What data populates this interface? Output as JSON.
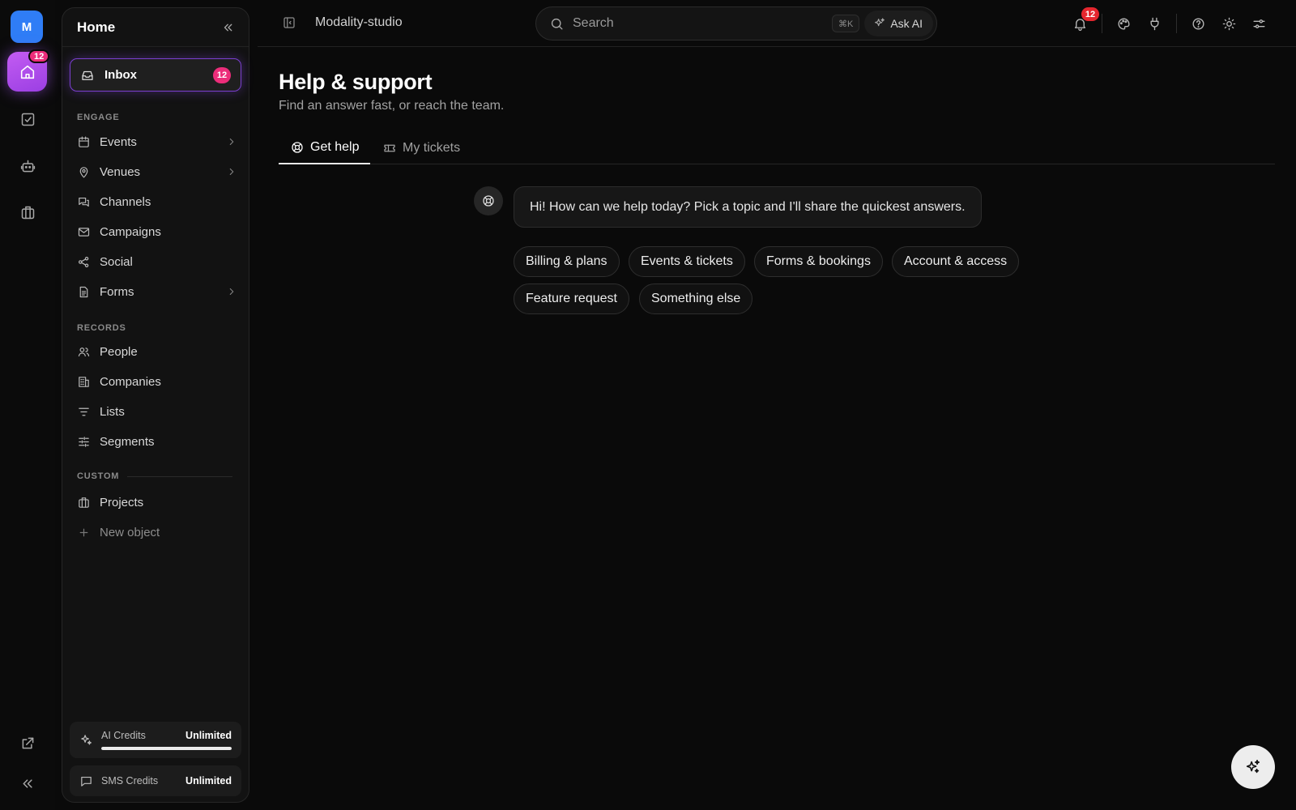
{
  "rail": {
    "avatar_letter": "M",
    "home_badge": "12"
  },
  "sidebar": {
    "title": "Home",
    "inbox": {
      "label": "Inbox",
      "badge": "12"
    },
    "sections": {
      "engage": "ENGAGE",
      "records": "RECORDS",
      "custom": "CUSTOM"
    },
    "engage_items": [
      {
        "label": "Events",
        "icon": "calendar-icon",
        "has_chevron": true
      },
      {
        "label": "Venues",
        "icon": "map-pin-icon",
        "has_chevron": true
      },
      {
        "label": "Channels",
        "icon": "chat-bubbles-icon",
        "has_chevron": false
      },
      {
        "label": "Campaigns",
        "icon": "mail-icon",
        "has_chevron": false
      },
      {
        "label": "Social",
        "icon": "share-icon",
        "has_chevron": false
      },
      {
        "label": "Forms",
        "icon": "document-icon",
        "has_chevron": true
      }
    ],
    "records_items": [
      {
        "label": "People",
        "icon": "users-icon"
      },
      {
        "label": "Companies",
        "icon": "building-icon"
      },
      {
        "label": "Lists",
        "icon": "list-filter-icon"
      },
      {
        "label": "Segments",
        "icon": "sliders-icon"
      }
    ],
    "custom_items": [
      {
        "label": "Projects",
        "icon": "briefcase-icon"
      },
      {
        "label": "New object",
        "icon": "plus-icon"
      }
    ],
    "credits": [
      {
        "name": "AI Credits",
        "value": "Unlimited",
        "fill": 1.0
      },
      {
        "name": "SMS Credits",
        "value": "Unlimited"
      }
    ]
  },
  "topbar": {
    "workspace": "Modality-studio",
    "search_placeholder": "Search",
    "shortcut": "⌘K",
    "ask_ai": "Ask AI",
    "notification_badge": "12"
  },
  "main": {
    "title": "Help & support",
    "subtitle": "Find an answer fast, or reach the team.",
    "tabs": [
      {
        "label": "Get help",
        "active": true
      },
      {
        "label": "My tickets",
        "active": false
      }
    ],
    "greeting": "Hi! How can we help today? Pick a topic and I'll share the quickest answers.",
    "topics": [
      "Billing & plans",
      "Events & tickets",
      "Forms & bookings",
      "Account & access",
      "Feature request",
      "Something else"
    ]
  },
  "colors": {
    "accent": "#a855f7",
    "badge": "#ec2d7a",
    "notification": "#e5262e",
    "avatar": "#2f7df6"
  }
}
